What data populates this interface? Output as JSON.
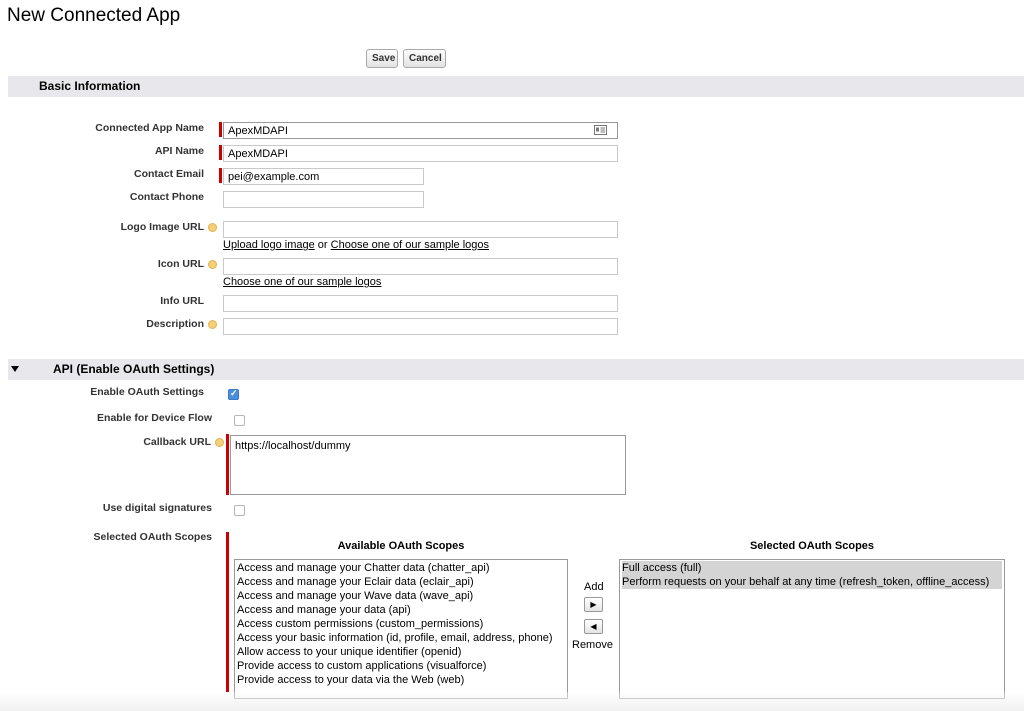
{
  "page": {
    "title": "New Connected App"
  },
  "toolbar": {
    "save_label": "Save",
    "cancel_label": "Cancel"
  },
  "basic": {
    "section_title": "Basic Information",
    "connected_app_name": {
      "label": "Connected App Name",
      "value": "ApexMDAPI"
    },
    "api_name": {
      "label": "API Name",
      "value": "ApexMDAPI"
    },
    "contact_email": {
      "label": "Contact Email",
      "value": "pei@example.com"
    },
    "contact_phone": {
      "label": "Contact Phone",
      "value": ""
    },
    "logo_image_url": {
      "label": "Logo Image URL",
      "value": "",
      "upload_link": "Upload logo image",
      "or_text": "or",
      "sample_link": "Choose one of our sample logos"
    },
    "icon_url": {
      "label": "Icon URL",
      "value": "",
      "sample_link": "Choose one of our sample logos"
    },
    "info_url": {
      "label": "Info URL",
      "value": ""
    },
    "description": {
      "label": "Description",
      "value": ""
    }
  },
  "api": {
    "section_title": "API (Enable OAuth Settings)",
    "enable_oauth": {
      "label": "Enable OAuth Settings",
      "checked": true
    },
    "device_flow": {
      "label": "Enable for Device Flow",
      "checked": false
    },
    "callback_url": {
      "label": "Callback URL",
      "value": "https://localhost/dummy"
    },
    "digital_signatures": {
      "label": "Use digital signatures",
      "checked": false
    },
    "scopes": {
      "label": "Selected OAuth Scopes",
      "available_title": "Available OAuth Scopes",
      "selected_title": "Selected OAuth Scopes",
      "add_label": "Add",
      "remove_label": "Remove",
      "available": [
        "Access and manage your Chatter data (chatter_api)",
        "Access and manage your Eclair data (eclair_api)",
        "Access and manage your Wave data (wave_api)",
        "Access and manage your data (api)",
        "Access custom permissions (custom_permissions)",
        "Access your basic information (id, profile, email, address, phone)",
        "Allow access to your unique identifier (openid)",
        "Provide access to custom applications (visualforce)",
        "Provide access to your data via the Web (web)"
      ],
      "selected": [
        "Full access (full)",
        "Perform requests on your behalf at any time (refresh_token, offline_access)"
      ]
    }
  },
  "colors": {
    "required": "#cc0000",
    "section_bg": "#e8e8ec",
    "checkbox_checked": "#4b8fdc"
  }
}
